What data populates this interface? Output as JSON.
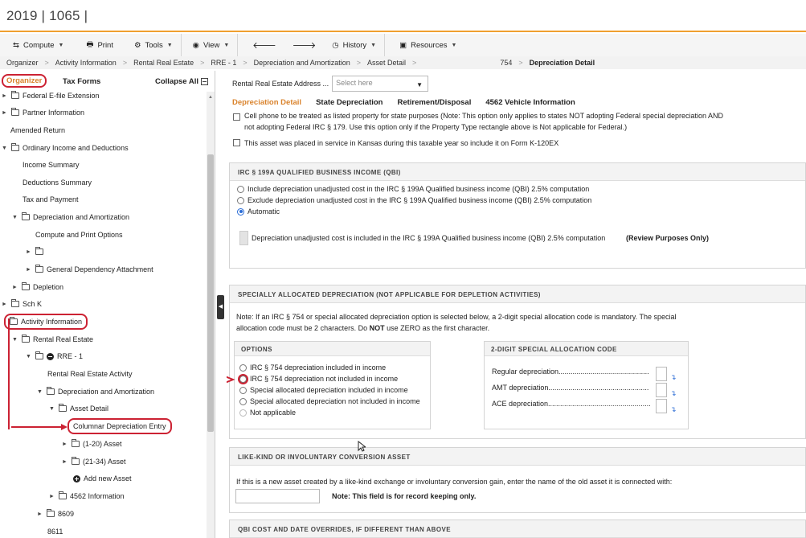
{
  "app": {
    "title": "2019 | 1065 |"
  },
  "toolbar": {
    "compute": "Compute",
    "print": "Print",
    "tools": "Tools",
    "view": "View",
    "history": "History",
    "resources": "Resources"
  },
  "breadcrumb": [
    "Organizer",
    "Activity Information",
    "Rental Real Estate",
    "RRE - 1",
    "Depreciation and Amortization",
    "Asset Detail",
    "754",
    "Depreciation Detail"
  ],
  "left": {
    "tab_organizer": "Organizer",
    "tab_taxforms": "Tax Forms",
    "collapse_all": "Collapse All",
    "tree": [
      "Federal E-file Extension",
      "Partner Information",
      "Amended Return",
      "Ordinary Income and Deductions",
      "Income Summary",
      "Deductions Summary",
      "Tax and Payment",
      "Depreciation and Amortization",
      "Compute and Print Options",
      "",
      "General Dependency Attachment",
      "Depletion",
      "Sch K",
      "Activity Information",
      "Rental Real Estate",
      "RRE - 1",
      "Rental Real Estate Activity",
      "Depreciation and Amortization",
      "Asset Detail",
      "Columnar Depreciation Entry",
      "(1-20) Asset",
      "(21-34) Asset",
      "Add new Asset",
      "4562 Information",
      "8609",
      "8611"
    ]
  },
  "right": {
    "address_label": "Rental Real Estate Address ...",
    "address_placeholder": "Select here",
    "tabs": [
      "Depreciation Detail",
      "State Depreciation",
      "Retirement/Disposal",
      "4562 Vehicle Information"
    ],
    "cb1_line1": "Cell phone to be treated as listed property for state purposes (Note: This option only applies to states NOT adopting Federal special depreciation AND",
    "cb1_line2": "not adopting Federal IRC § 179. Use this option only if the Property Type rectangle above is Not applicable for Federal.)",
    "cb2": "This asset was placed in service in Kansas during this taxable year so include it on Form K-120EX",
    "qbi": {
      "header": "IRC § 199A QUALIFIED BUSINESS INCOME (QBI)",
      "opt1": "Include depreciation unadjusted cost in the IRC § 199A Qualified business income (QBI) 2.5% computation",
      "opt2": "Exclude depreciation unadjusted cost in the IRC § 199A Qualified business income (QBI) 2.5% computation",
      "opt3": "Automatic",
      "info": "Depreciation unadjusted cost is included in the IRC § 199A Qualified business income (QBI) 2.5% computation",
      "review": "(Review Purposes Only)"
    },
    "special": {
      "header": "SPECIALLY ALLOCATED DEPRECIATION (NOT APPLICABLE FOR DEPLETION ACTIVITIES)",
      "note1": "Note: If an IRC § 754 or special allocated depreciation option is selected below, a 2-digit special allocation code is mandatory. The special",
      "note2_a": "allocation code must be 2 characters.   Do ",
      "note2_b": "NOT",
      "note2_c": " use ZERO as the first character.",
      "options_header": "OPTIONS",
      "options": [
        "IRC § 754 depreciation included in income",
        "IRC § 754 depreciation not included in income",
        "Special allocated depreciation included in income",
        "Special allocated depreciation not included in income",
        "Not applicable"
      ],
      "code_header": "2-DIGIT SPECIAL ALLOCATION CODE",
      "regular": "Regular depreciation.............................................",
      "amt": "AMT depreciation..................................................",
      "ace": "ACE depreciation..................................................."
    },
    "likekind": {
      "header": "LIKE-KIND OR INVOLUNTARY CONVERSION ASSET",
      "text": "If this is a new asset created by a like-kind exchange or involuntary conversion gain, enter the name of the old asset it is connected with:",
      "note": "Note: This field is for record keeping only."
    },
    "qbi_overrides": {
      "header": "QBI COST AND DATE OVERRIDES, IF DIFFERENT THAN ABOVE"
    }
  },
  "colors": {
    "accent": "#d9822b",
    "annotation": "#cc2233",
    "radio": "#2a6cd6"
  }
}
